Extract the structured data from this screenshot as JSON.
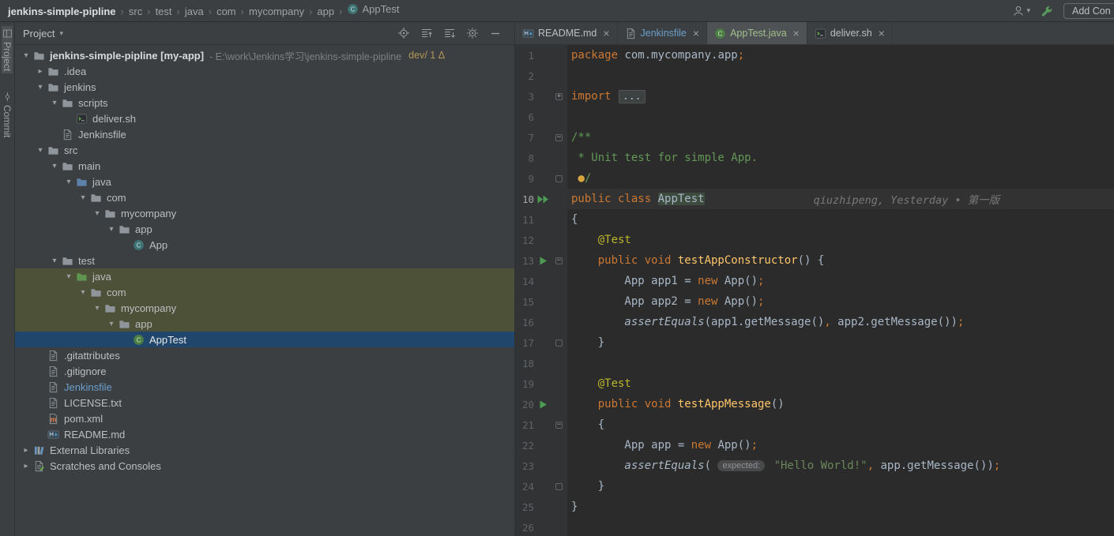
{
  "colors": {
    "panel_bg": "#3c3f41",
    "editor_bg": "#2b2b2b",
    "gutter_bg": "#313335",
    "selection_blue": "#21466b",
    "olive_highlight": "#4d5138",
    "keyword_orange": "#cc7832",
    "string_green": "#6a8759",
    "comment_green": "#629755",
    "method_yellow": "#ffc66b",
    "annotation_yellow": "#bbb529",
    "run_green": "#4d9b53",
    "branch_gold": "#b5975a"
  },
  "breadcrumbs": {
    "separator": "›",
    "items": [
      {
        "label": "jenkins-simple-pipline",
        "bold": true
      },
      {
        "label": "src"
      },
      {
        "label": "test"
      },
      {
        "label": "java"
      },
      {
        "label": "com"
      },
      {
        "label": "mycompany"
      },
      {
        "label": "app"
      },
      {
        "label": "AppTest",
        "icon": "class"
      }
    ]
  },
  "top_right": {
    "user_caret": "▾",
    "add_config_label": "Add Con"
  },
  "stripe": {
    "project_label": "Project",
    "commit_label": "Commit"
  },
  "project_panel": {
    "title": "Project",
    "caret": "▾",
    "header_icons": [
      "locate",
      "expandall",
      "collapseall",
      "gear",
      "minus"
    ],
    "tree": [
      {
        "label": "jenkins-simple-pipline [my-app]",
        "bold": true,
        "suffix": "- E:\\work\\Jenkins学习\\jenkins-simple-pipline",
        "branch": "dev/ 1 Δ",
        "indent": 0,
        "icon": "folder",
        "chevron": "down"
      },
      {
        "label": ".idea",
        "indent": 1,
        "icon": "folder",
        "chevron": "right"
      },
      {
        "label": "jenkins",
        "indent": 1,
        "icon": "folder",
        "chevron": "down"
      },
      {
        "label": "scripts",
        "indent": 2,
        "icon": "folder",
        "chevron": "down"
      },
      {
        "label": "deliver.sh",
        "indent": 3,
        "icon": "shell",
        "chevron": null
      },
      {
        "label": "Jenkinsfile",
        "indent": 2,
        "icon": "file",
        "chevron": null
      },
      {
        "label": "src",
        "indent": 1,
        "icon": "folder",
        "chevron": "down"
      },
      {
        "label": "main",
        "indent": 2,
        "icon": "folder",
        "chevron": "down"
      },
      {
        "label": "java",
        "indent": 3,
        "icon": "folder-src",
        "chevron": "down"
      },
      {
        "label": "com",
        "indent": 4,
        "icon": "folder",
        "chevron": "down"
      },
      {
        "label": "mycompany",
        "indent": 5,
        "icon": "folder",
        "chevron": "down"
      },
      {
        "label": "app",
        "indent": 6,
        "icon": "folder",
        "chevron": "down"
      },
      {
        "label": "App",
        "indent": 7,
        "icon": "class",
        "chevron": null
      },
      {
        "label": "test",
        "indent": 2,
        "icon": "folder",
        "chevron": "down"
      },
      {
        "label": "java",
        "indent": 3,
        "icon": "folder-test",
        "chevron": "down",
        "row_bg": "olive"
      },
      {
        "label": "com",
        "indent": 4,
        "icon": "folder",
        "chevron": "down",
        "row_bg": "olive"
      },
      {
        "label": "mycompany",
        "indent": 5,
        "icon": "folder",
        "chevron": "down",
        "row_bg": "olive"
      },
      {
        "label": "app",
        "indent": 6,
        "icon": "folder",
        "chevron": "down",
        "row_bg": "olive"
      },
      {
        "label": "AppTest",
        "indent": 7,
        "icon": "class-test",
        "chevron": null,
        "row_bg": "selected"
      },
      {
        "label": ".gitattributes",
        "indent": 1,
        "icon": "file",
        "chevron": null
      },
      {
        "label": ".gitignore",
        "indent": 1,
        "icon": "file",
        "chevron": null
      },
      {
        "label": "Jenkinsfile",
        "indent": 1,
        "icon": "file",
        "chevron": null,
        "color": "#6a9fcb"
      },
      {
        "label": "LICENSE.txt",
        "indent": 1,
        "icon": "file",
        "chevron": null
      },
      {
        "label": "pom.xml",
        "indent": 1,
        "icon": "maven",
        "chevron": null
      },
      {
        "label": "README.md",
        "indent": 1,
        "icon": "markdown",
        "chevron": null
      },
      {
        "label": "External Libraries",
        "indent": 0,
        "icon": "libs",
        "chevron": "right"
      },
      {
        "label": "Scratches and Consoles",
        "indent": 0,
        "icon": "scratch",
        "chevron": "right"
      }
    ]
  },
  "editor_tabs": [
    {
      "label": "README.md",
      "icon": "markdown",
      "close": "×"
    },
    {
      "label": "Jenkinsfile",
      "icon": "file",
      "label_color": "#6a9fcb",
      "close": "×"
    },
    {
      "label": "AppTest.java",
      "icon": "class-test",
      "active": true,
      "label_color": "#a3be8c",
      "close": "×"
    },
    {
      "label": "deliver.sh",
      "icon": "shell",
      "close": "×"
    }
  ],
  "editor": {
    "lines": [
      {
        "n": "1",
        "tokens": [
          [
            "kw",
            "package"
          ],
          [
            "df",
            " com.mycompany.app"
          ],
          [
            "pn",
            ";"
          ]
        ]
      },
      {
        "n": "2",
        "tokens": []
      },
      {
        "n": "3",
        "fold": "plus",
        "tokens": [
          [
            "kw",
            "import"
          ],
          [
            "df",
            " "
          ],
          [
            "fb",
            "..."
          ]
        ]
      },
      {
        "n": "6",
        "tokens": []
      },
      {
        "n": "7",
        "fold": "minus",
        "tokens": [
          [
            "cm",
            "/**"
          ]
        ]
      },
      {
        "n": "8",
        "tokens": [
          [
            "cm",
            " * Unit test for simple App."
          ]
        ]
      },
      {
        "n": "9",
        "fold": "end",
        "tokens": [
          [
            "cm",
            " "
          ],
          [
            "bulb",
            "●"
          ],
          [
            "cm",
            "/"
          ]
        ]
      },
      {
        "n": "10",
        "run": "dplay",
        "cur": true,
        "tokens": [
          [
            "kw",
            "public class"
          ],
          [
            "df",
            " "
          ],
          [
            "hl",
            "AppTest"
          ],
          [
            "blame",
            "qiuzhipeng, Yesterday • 第一版"
          ]
        ]
      },
      {
        "n": "11",
        "tokens": [
          [
            "df",
            "{"
          ]
        ]
      },
      {
        "n": "12",
        "tokens": [
          [
            "an",
            "    @Test"
          ]
        ]
      },
      {
        "n": "13",
        "run": "play",
        "fold": "minus",
        "tokens": [
          [
            "kw",
            "    public void "
          ],
          [
            "md",
            "testAppConstructor"
          ],
          [
            "df",
            "() {"
          ]
        ]
      },
      {
        "n": "14",
        "tokens": [
          [
            "df",
            "        App app1 = "
          ],
          [
            "kw",
            "new"
          ],
          [
            "df",
            " App()"
          ],
          [
            "pn",
            ";"
          ]
        ]
      },
      {
        "n": "15",
        "tokens": [
          [
            "df",
            "        App app2 = "
          ],
          [
            "kw",
            "new"
          ],
          [
            "df",
            " App()"
          ],
          [
            "pn",
            ";"
          ]
        ]
      },
      {
        "n": "16",
        "tokens": [
          [
            "it",
            "        assertEquals"
          ],
          [
            "df",
            "(app1.getMessage()"
          ],
          [
            "pn",
            ","
          ],
          [
            "df",
            " app2.getMessage())"
          ],
          [
            "pn",
            ";"
          ]
        ]
      },
      {
        "n": "17",
        "fold": "end",
        "tokens": [
          [
            "df",
            "    }"
          ]
        ]
      },
      {
        "n": "18",
        "tokens": []
      },
      {
        "n": "19",
        "tokens": [
          [
            "an",
            "    @Test"
          ]
        ]
      },
      {
        "n": "20",
        "run": "play",
        "tokens": [
          [
            "kw",
            "    public void "
          ],
          [
            "md",
            "testAppMessage"
          ],
          [
            "df",
            "()"
          ]
        ]
      },
      {
        "n": "21",
        "fold": "minus",
        "tokens": [
          [
            "df",
            "    {"
          ]
        ]
      },
      {
        "n": "22",
        "tokens": [
          [
            "df",
            "        App app = "
          ],
          [
            "kw",
            "new"
          ],
          [
            "df",
            " App()"
          ],
          [
            "pn",
            ";"
          ]
        ]
      },
      {
        "n": "23",
        "tokens": [
          [
            "it",
            "        assertEquals"
          ],
          [
            "df",
            "( "
          ],
          [
            "hint",
            "expected:"
          ],
          [
            "df",
            " "
          ],
          [
            "st",
            "\"Hello World!\""
          ],
          [
            "pn",
            ","
          ],
          [
            "df",
            " app.getMessage())"
          ],
          [
            "pn",
            ";"
          ]
        ]
      },
      {
        "n": "24",
        "fold": "end",
        "tokens": [
          [
            "df",
            "    }"
          ]
        ]
      },
      {
        "n": "25",
        "tokens": [
          [
            "df",
            "}"
          ]
        ]
      },
      {
        "n": "26",
        "tokens": []
      }
    ]
  }
}
